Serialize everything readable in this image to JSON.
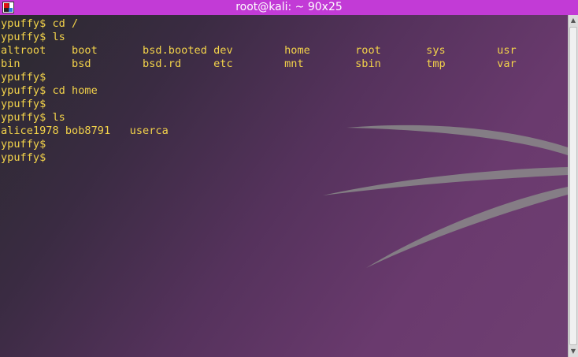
{
  "window": {
    "title": "root@kali: ~ 90x25",
    "icon": "terminal-app-icon"
  },
  "terminal": {
    "text_color": "#f2d24a",
    "lines": [
      "ypuffy$ cd /",
      "ypuffy$ ls",
      "altroot    boot       bsd.booted dev        home       root       sys        usr",
      "bin        bsd        bsd.rd     etc        mnt        sbin       tmp        var",
      "ypuffy$",
      "ypuffy$ cd home",
      "ypuffy$",
      "ypuffy$ ls",
      "alice1978 bob8791   userca",
      "ypuffy$",
      "ypuffy$"
    ]
  },
  "scrollbar": {
    "up_icon": "arrow-up-icon",
    "down_icon": "arrow-down-icon"
  }
}
